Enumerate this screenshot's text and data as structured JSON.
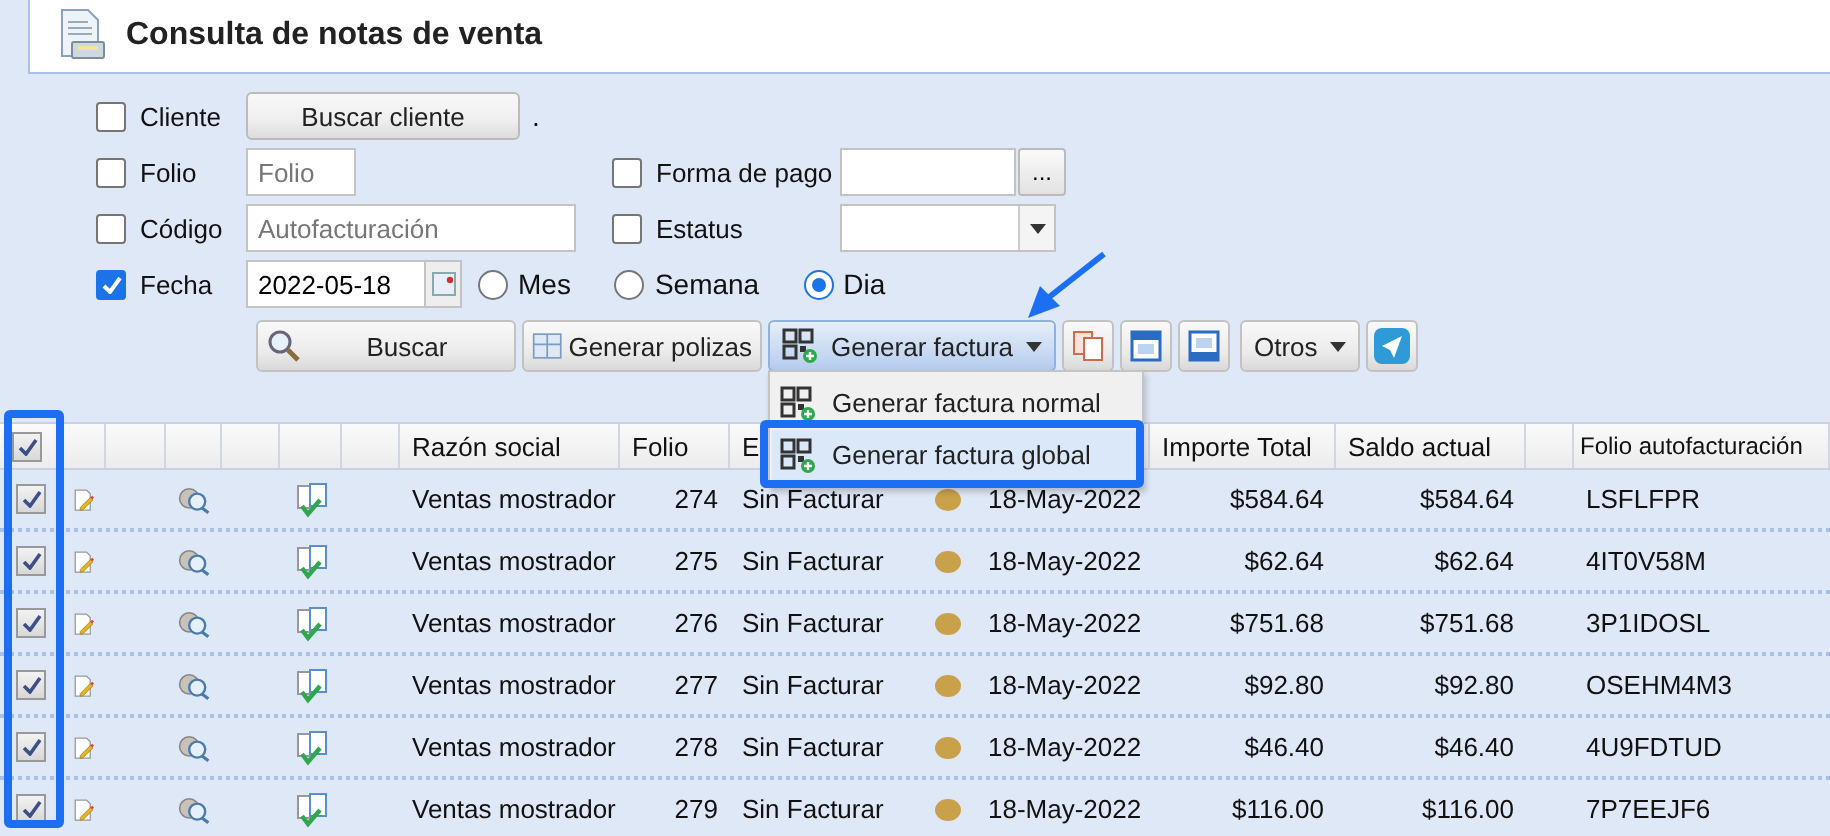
{
  "header": {
    "title": "Consulta de notas de venta"
  },
  "filters_left": [
    {
      "kind": "button",
      "label": "Cliente",
      "checked": false,
      "button": "Buscar cliente",
      "suffix": "."
    },
    {
      "kind": "input",
      "label": "Folio",
      "checked": false,
      "placeholder": "Folio"
    },
    {
      "kind": "input",
      "label": "Código",
      "checked": false,
      "placeholder": "Autofacturación"
    },
    {
      "kind": "date",
      "label": "Fecha",
      "checked": true,
      "value": "2022-05-18"
    }
  ],
  "filters_right": [
    {
      "kind": "combo",
      "label": "Forma de pago",
      "checked": false,
      "button": "..."
    },
    {
      "kind": "select",
      "label": "Estatus",
      "checked": false
    }
  ],
  "date_range": [
    {
      "label": "Mes",
      "selected": false
    },
    {
      "label": "Semana",
      "selected": false
    },
    {
      "label": "Dia",
      "selected": true
    }
  ],
  "toolbar": [
    {
      "kind": "button",
      "label": "Buscar"
    },
    {
      "kind": "button",
      "label": "Generar polizas"
    },
    {
      "kind": "split",
      "label": "Generar factura",
      "expanded": true
    },
    {
      "kind": "icon"
    },
    {
      "kind": "icon"
    },
    {
      "kind": "icon"
    },
    {
      "kind": "menu",
      "label": "Otros"
    },
    {
      "kind": "icon"
    }
  ],
  "dropdown_menu": {
    "items": [
      {
        "label": "Generar factura normal",
        "selected": false
      },
      {
        "label": "Generar factura global",
        "selected": true
      }
    ]
  },
  "table": {
    "all_checked": true,
    "columns": [
      {
        "label": "Razón social"
      },
      {
        "label": "Folio"
      },
      {
        "label": "E"
      },
      {
        "label": "Importe Total"
      },
      {
        "label": "Saldo actual"
      },
      {
        "label": "Folio autofacturación"
      }
    ],
    "rows": [
      {
        "checked": true,
        "razon_social": "Ventas mostrador",
        "folio": "274",
        "estatus": "Sin Facturar",
        "fecha": "18-May-2022",
        "importe": "$584.64",
        "saldo": "$584.64",
        "folio_auto": "LSFLFPR"
      },
      {
        "checked": true,
        "razon_social": "Ventas mostrador",
        "folio": "275",
        "estatus": "Sin Facturar",
        "fecha": "18-May-2022",
        "importe": "$62.64",
        "saldo": "$62.64",
        "folio_auto": "4IT0V58M"
      },
      {
        "checked": true,
        "razon_social": "Ventas mostrador",
        "folio": "276",
        "estatus": "Sin Facturar",
        "fecha": "18-May-2022",
        "importe": "$751.68",
        "saldo": "$751.68",
        "folio_auto": "3P1IDOSL"
      },
      {
        "checked": true,
        "razon_social": "Ventas mostrador",
        "folio": "277",
        "estatus": "Sin Facturar",
        "fecha": "18-May-2022",
        "importe": "$92.80",
        "saldo": "$92.80",
        "folio_auto": "OSEHM4M3"
      },
      {
        "checked": true,
        "razon_social": "Ventas mostrador",
        "folio": "278",
        "estatus": "Sin Facturar",
        "fecha": "18-May-2022",
        "importe": "$46.40",
        "saldo": "$46.40",
        "folio_auto": "4U9FDTUD"
      },
      {
        "checked": true,
        "razon_social": "Ventas mostrador",
        "folio": "279",
        "estatus": "Sin Facturar",
        "fecha": "18-May-2022",
        "importe": "$116.00",
        "saldo": "$116.00",
        "folio_auto": "7P7EEJF6"
      }
    ]
  }
}
